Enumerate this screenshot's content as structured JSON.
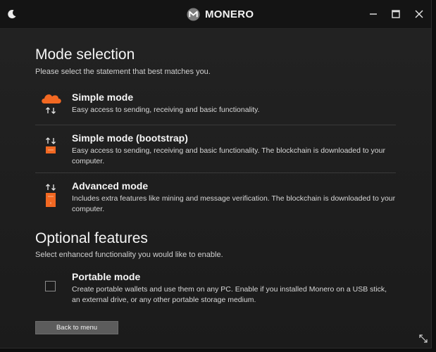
{
  "titlebar": {
    "app_name": "MONERO",
    "icons": [
      "moon-icon",
      "monero-logo",
      "minimize-icon",
      "maximize-icon",
      "close-icon"
    ]
  },
  "mode_section": {
    "title": "Mode selection",
    "subtitle": "Please select the statement that best matches you.",
    "options": [
      {
        "title": "Simple mode",
        "description": "Easy access to sending, receiving and basic functionality.",
        "icon": "cloud-transfer-icon"
      },
      {
        "title": "Simple mode (bootstrap)",
        "description": "Easy access to sending, receiving and basic functionality. The blockchain is downloaded to your computer.",
        "icon": "transfer-small-drive-icon"
      },
      {
        "title": "Advanced mode",
        "description": "Includes extra features like mining and message verification. The blockchain is downloaded to your computer.",
        "icon": "transfer-tall-drive-icon"
      }
    ]
  },
  "optional_section": {
    "title": "Optional features",
    "subtitle": "Select enhanced functionality you would like to enable.",
    "portable": {
      "title": "Portable mode",
      "description": "Create portable wallets and use them on any PC. Enable if you installed Monero on a USB stick, an external drive, or any other portable storage medium.",
      "checked": false
    }
  },
  "footer": {
    "back_label": "Back to menu"
  },
  "colors": {
    "accent": "#f26822",
    "background": "#1f1f1f",
    "titlebar": "#141414"
  }
}
